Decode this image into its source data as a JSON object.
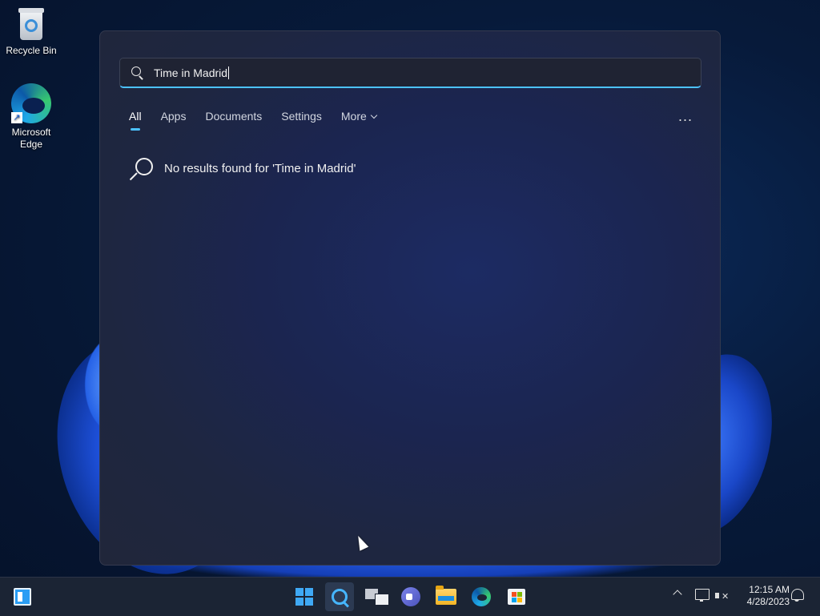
{
  "desktop": {
    "icons": [
      {
        "label": "Recycle Bin",
        "icon": "recycle-bin-icon"
      },
      {
        "label": "Microsoft Edge",
        "icon": "edge-icon"
      }
    ]
  },
  "search": {
    "query": "Time in Madrid",
    "tabs": [
      {
        "label": "All",
        "active": true
      },
      {
        "label": "Apps",
        "active": false
      },
      {
        "label": "Documents",
        "active": false
      },
      {
        "label": "Settings",
        "active": false
      },
      {
        "label": "More",
        "active": false
      }
    ],
    "more_options": "...",
    "no_results_text": "No results found for 'Time in Madrid'"
  },
  "taskbar": {
    "apps": [
      "widgets-icon",
      "start-icon",
      "search-icon",
      "task-view-icon",
      "chat-icon",
      "file-explorer-icon",
      "edge-icon",
      "store-icon"
    ],
    "clock": {
      "time": "12:15 AM",
      "date": "4/28/2023"
    }
  },
  "colors": {
    "accent": "#4cc2ff",
    "taskbar": "#1b2434"
  }
}
